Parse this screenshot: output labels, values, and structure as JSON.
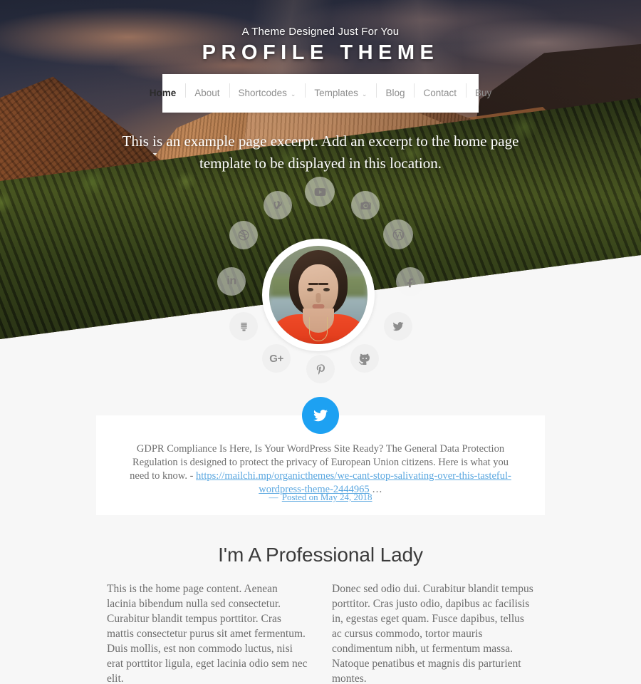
{
  "header": {
    "tagline": "A Theme Designed Just For You",
    "site_title": "PROFILE THEME"
  },
  "nav": {
    "items": [
      {
        "label": "Home",
        "active": true,
        "has_dropdown": false
      },
      {
        "label": "About",
        "active": false,
        "has_dropdown": false
      },
      {
        "label": "Shortcodes",
        "active": false,
        "has_dropdown": true
      },
      {
        "label": "Templates",
        "active": false,
        "has_dropdown": true
      },
      {
        "label": "Blog",
        "active": false,
        "has_dropdown": false
      },
      {
        "label": "Contact",
        "active": false,
        "has_dropdown": false
      },
      {
        "label": "Buy",
        "active": false,
        "has_dropdown": false
      }
    ],
    "caret_glyph": "⌄"
  },
  "hero": {
    "excerpt": "This is an example page excerpt. Add an excerpt to the home page template to be displayed in this location.",
    "avatar_name": "avatar-portrait"
  },
  "social": {
    "icons": [
      {
        "name": "vine-icon",
        "label": "Vine"
      },
      {
        "name": "youtube-icon",
        "label": "YouTube"
      },
      {
        "name": "instagram-icon",
        "label": "Instagram"
      },
      {
        "name": "dribbble-icon",
        "label": "Dribbble"
      },
      {
        "name": "wordpress-icon",
        "label": "WordPress"
      },
      {
        "name": "linkedin-icon",
        "label": "LinkedIn"
      },
      {
        "name": "facebook-icon",
        "label": "Facebook"
      },
      {
        "name": "slideshare-icon",
        "label": "SlideShare"
      },
      {
        "name": "twitter-icon",
        "label": "Twitter"
      },
      {
        "name": "googleplus-icon",
        "label": "Google Plus"
      },
      {
        "name": "pinterest-icon",
        "label": "Pinterest"
      },
      {
        "name": "github-icon",
        "label": "GitHub"
      }
    ],
    "googleplus_glyph": "G+",
    "linkedin_glyph": "in"
  },
  "tweet": {
    "icon_name": "twitter-icon",
    "icon_color": "#1da1f2",
    "text_before_link": "GDPR Compliance Is Here, Is Your WordPress Site Ready? The General Data Protection Regulation is designed to protect the privacy of European Union citizens. Here is what you need to know. - ",
    "link_text": "https://mailchi.mp/organicthemes/we-cant-stop-salivating-over-this-tasteful-wordpress-theme-2444965",
    "text_after_link": " …",
    "meta_dash": "— ",
    "meta_link": "Posted on May 24, 2018",
    "link_color": "#5aa7e0"
  },
  "main": {
    "heading": "I'm A Professional Lady",
    "columns": [
      "This is the home page content. Aenean lacinia bibendum nulla sed consectetur. Curabitur blandit tempus porttitor. Cras mattis consectetur purus sit amet fermentum. Duis mollis, est non commodo luctus, nisi erat porttitor ligula, eget lacinia odio sem nec elit.",
      "Donec sed odio dui. Curabitur blandit tempus porttitor. Cras justo odio, dapibus ac facilisis in, egestas eget quam. Fusce dapibus, tellus ac cursus commodo, tortor mauris condimentum nibh, ut fermentum massa. Natoque penatibus et magnis dis parturient montes."
    ]
  }
}
